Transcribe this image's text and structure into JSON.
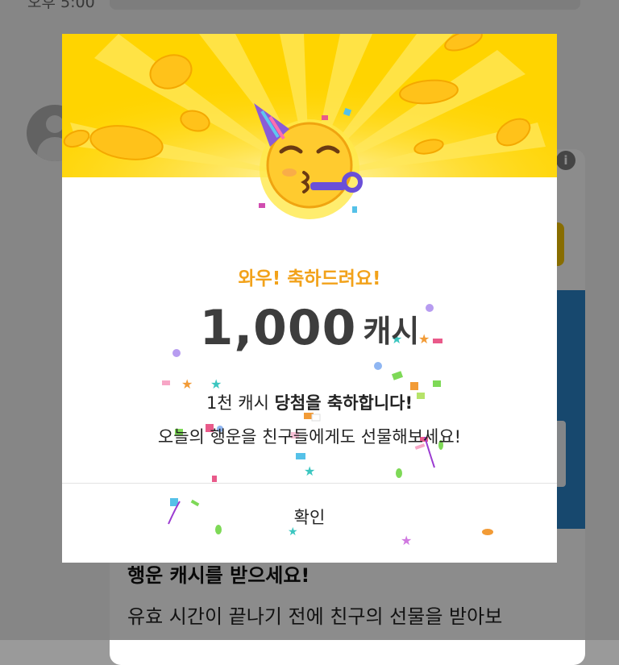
{
  "background": {
    "time_label": "오후 5:00",
    "card_heading": "행운 캐시를 받으세요!",
    "card_text": "유효 시간이 끝나기 전에 친구의 선물을 받아보",
    "info_icon": "info-icon"
  },
  "modal": {
    "title": "와우! 축하드려요!",
    "amount_number": "1,000",
    "amount_unit": "캐시",
    "message_prefix": "1천 캐시 ",
    "message_bold": "당첨을 축하합니다!",
    "message_line2": "오늘의 행운을 친구들에게도 선물해보세요!",
    "confirm_label": "확인",
    "emoji_icon": "party-face-emoji-icon"
  },
  "colors": {
    "banner": "#ffd400",
    "title": "#f2a21a",
    "amount": "#3d3d3d",
    "coin": "#ffc21a"
  }
}
